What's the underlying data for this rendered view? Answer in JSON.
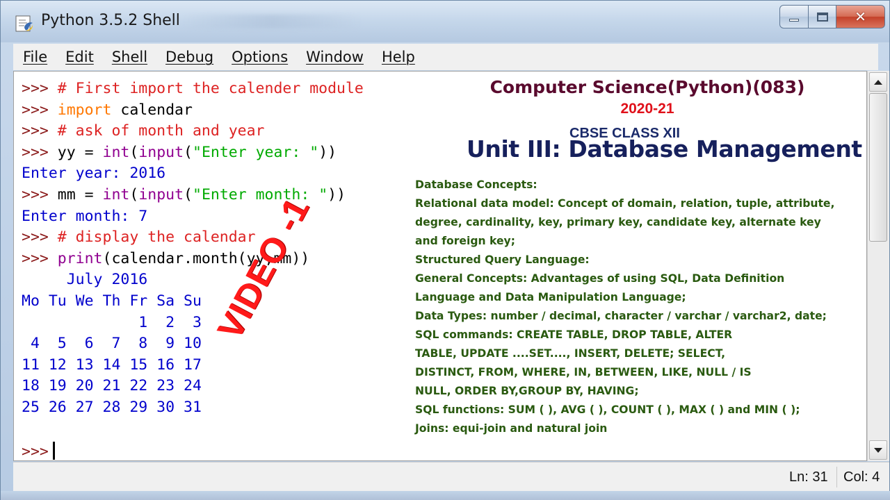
{
  "window": {
    "title": "Python 3.5.2 Shell"
  },
  "menu": {
    "items": [
      "File",
      "Edit",
      "Shell",
      "Debug",
      "Options",
      "Window",
      "Help"
    ]
  },
  "shell": {
    "lines": [
      [
        {
          "t": ">>> ",
          "c": "prompt"
        },
        {
          "t": "# First import the calender module",
          "c": "comment"
        }
      ],
      [
        {
          "t": ">>> ",
          "c": "prompt"
        },
        {
          "t": "import",
          "c": "kw"
        },
        {
          "t": " calendar",
          "c": "plain"
        }
      ],
      [
        {
          "t": ">>> ",
          "c": "prompt"
        },
        {
          "t": "# ask of month and year",
          "c": "comment"
        }
      ],
      [
        {
          "t": ">>> ",
          "c": "prompt"
        },
        {
          "t": "yy = ",
          "c": "plain"
        },
        {
          "t": "int",
          "c": "builtin"
        },
        {
          "t": "(",
          "c": "plain"
        },
        {
          "t": "input",
          "c": "builtin"
        },
        {
          "t": "(",
          "c": "plain"
        },
        {
          "t": "\"Enter year: \"",
          "c": "str"
        },
        {
          "t": "))",
          "c": "plain"
        }
      ],
      [
        {
          "t": "Enter year: 2016",
          "c": "stdout"
        }
      ],
      [
        {
          "t": ">>> ",
          "c": "prompt"
        },
        {
          "t": "mm = ",
          "c": "plain"
        },
        {
          "t": "int",
          "c": "builtin"
        },
        {
          "t": "(",
          "c": "plain"
        },
        {
          "t": "input",
          "c": "builtin"
        },
        {
          "t": "(",
          "c": "plain"
        },
        {
          "t": "\"Enter month: \"",
          "c": "str"
        },
        {
          "t": "))",
          "c": "plain"
        }
      ],
      [
        {
          "t": "Enter month: 7",
          "c": "stdout"
        }
      ],
      [
        {
          "t": ">>> ",
          "c": "prompt"
        },
        {
          "t": "# display the calendar",
          "c": "comment"
        }
      ],
      [
        {
          "t": ">>> ",
          "c": "prompt"
        },
        {
          "t": "print",
          "c": "builtin"
        },
        {
          "t": "(calendar.month(yy,mm))",
          "c": "plain"
        }
      ],
      [
        {
          "t": "     July 2016",
          "c": "stdout"
        }
      ],
      [
        {
          "t": "Mo Tu We Th Fr Sa Su",
          "c": "stdout"
        }
      ],
      [
        {
          "t": "             1  2  3",
          "c": "stdout"
        }
      ],
      [
        {
          "t": " 4  5  6  7  8  9 10",
          "c": "stdout"
        }
      ],
      [
        {
          "t": "11 12 13 14 15 16 17",
          "c": "stdout"
        }
      ],
      [
        {
          "t": "18 19 20 21 22 23 24",
          "c": "stdout"
        }
      ],
      [
        {
          "t": "25 26 27 28 29 30 31",
          "c": "stdout"
        }
      ]
    ],
    "current_prompt": ">>>"
  },
  "overlay": {
    "title": "Computer Science(Python)(083)",
    "year": "2020-21",
    "class": "CBSE CLASS XII",
    "unit": "Unit III: Database Management",
    "syllabus": [
      "Database Concepts:",
      "Relational data model: Concept of domain, relation, tuple, attribute,",
      "degree, cardinality, key, primary key, candidate key, alternate key",
      "and foreign key;",
      "Structured Query Language:",
      "General Concepts: Advantages of using SQL, Data Definition",
      "Language and Data Manipulation Language;",
      "Data Types: number / decimal, character / varchar / varchar2, date;",
      "SQL commands: CREATE TABLE, DROP TABLE, ALTER",
      "TABLE, UPDATE ....SET...., INSERT, DELETE; SELECT,",
      "DISTINCT, FROM, WHERE, IN, BETWEEN, LIKE, NULL / IS",
      "NULL, ORDER BY,GROUP BY, HAVING;",
      "SQL functions: SUM ( ), AVG ( ), COUNT ( ), MAX ( ) and MIN ( );",
      "Joins: equi-join and natural join"
    ],
    "watermark": "VIDEO -1"
  },
  "status": {
    "ln": "Ln: 31",
    "col": "Col: 4"
  },
  "colors": {
    "prompt": "#8b1a1a",
    "comment": "#dd2222",
    "keyword": "#ff7700",
    "builtin": "#900090",
    "string": "#00aa00",
    "stdout": "#0000cc",
    "overlay_title": "#5a0a2e",
    "overlay_year": "#e0101a",
    "overlay_unit": "#16205c",
    "syllabus": "#2a5a10",
    "watermark": "#ff1a1a"
  }
}
